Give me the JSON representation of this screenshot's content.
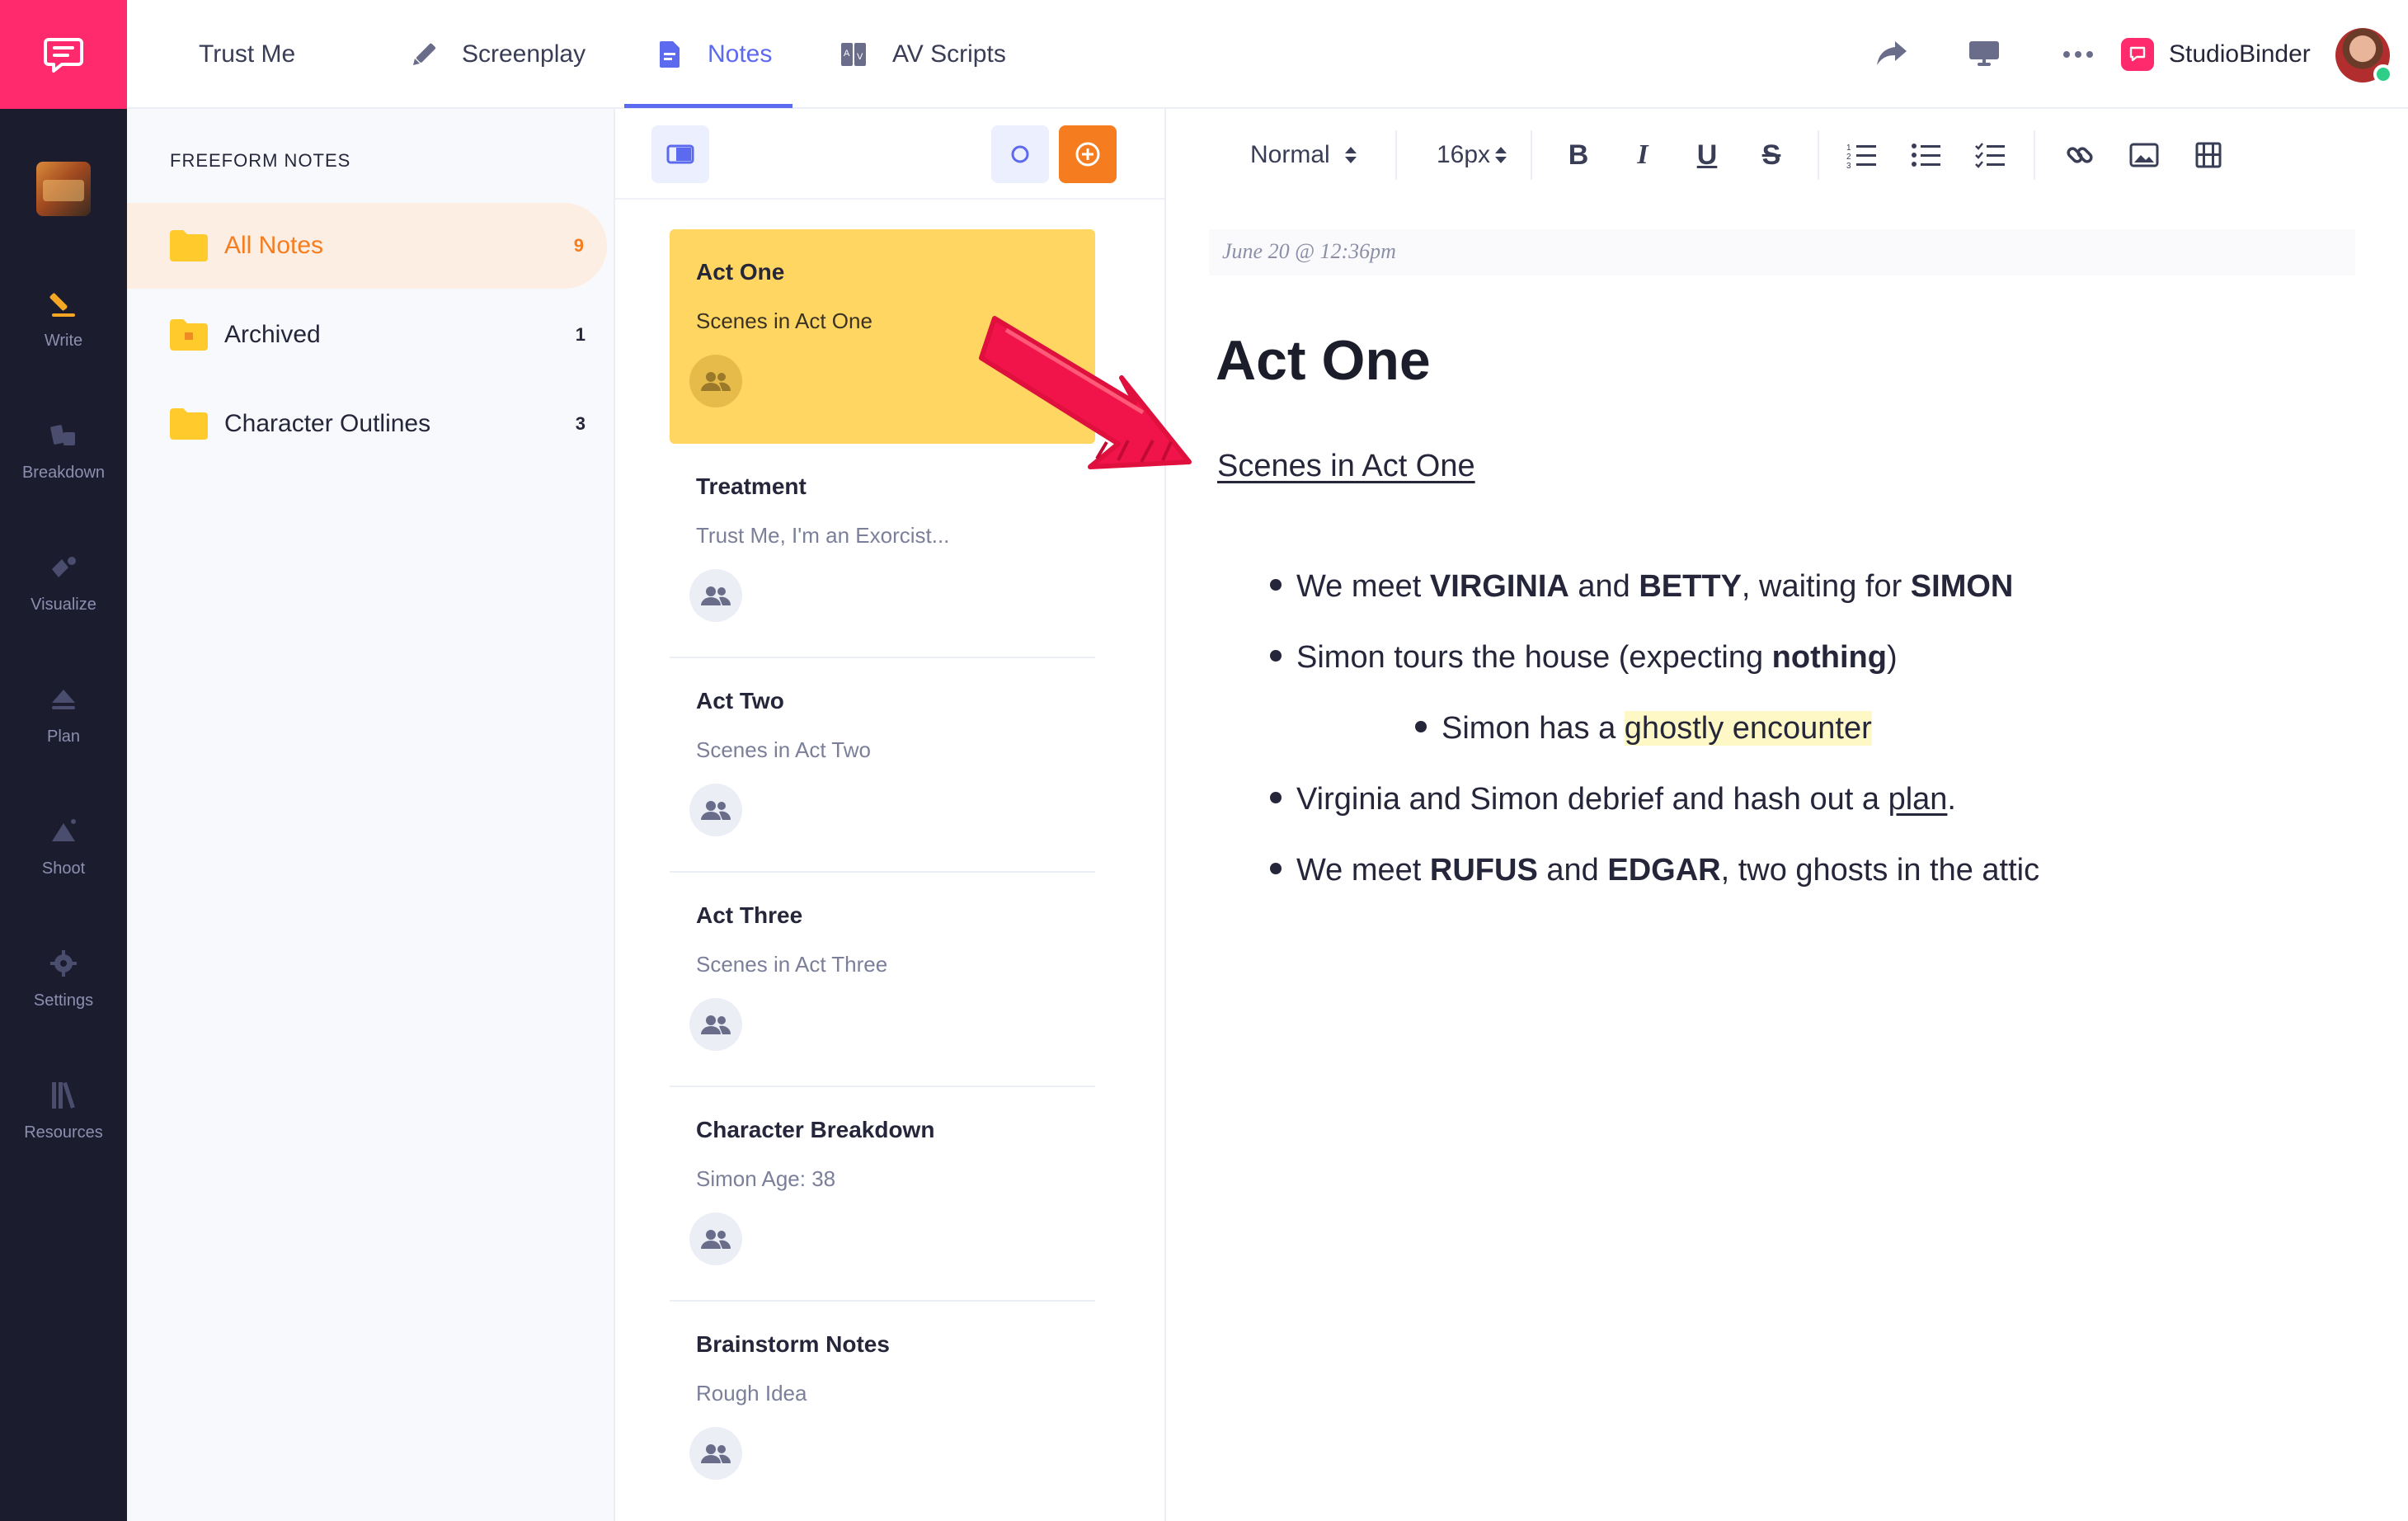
{
  "app": {
    "brand_color": "#ff2a6d",
    "accent_color": "#5c6af0",
    "orange_color": "#f57c1f"
  },
  "rail": {
    "items": [
      {
        "label": "Write",
        "icon": "pencil-icon"
      },
      {
        "label": "Breakdown",
        "icon": "breakdown-icon"
      },
      {
        "label": "Visualize",
        "icon": "visualize-icon"
      },
      {
        "label": "Plan",
        "icon": "plan-icon"
      },
      {
        "label": "Shoot",
        "icon": "shoot-icon"
      },
      {
        "label": "Settings",
        "icon": "gear-icon"
      },
      {
        "label": "Resources",
        "icon": "books-icon"
      }
    ]
  },
  "topbar": {
    "project": "Trust Me",
    "tabs": [
      {
        "label": "Screenplay",
        "icon": "pencil-icon"
      },
      {
        "label": "Notes",
        "icon": "document-icon",
        "active": true
      },
      {
        "label": "AV Scripts",
        "icon": "av-script-icon"
      }
    ],
    "account": "StudioBinder"
  },
  "folders": {
    "heading": "FREEFORM NOTES",
    "items": [
      {
        "name": "All Notes",
        "count": "9",
        "active": true
      },
      {
        "name": "Archived",
        "count": "1"
      },
      {
        "name": "Character Outlines",
        "count": "3"
      }
    ]
  },
  "notes": {
    "items": [
      {
        "title": "Act One",
        "subtitle": "Scenes in Act One",
        "selected": true
      },
      {
        "title": "Treatment",
        "subtitle": "Trust Me, I'm an Exorcist..."
      },
      {
        "title": "Act Two",
        "subtitle": "Scenes in Act Two"
      },
      {
        "title": "Act Three",
        "subtitle": "Scenes in Act Three"
      },
      {
        "title": "Character Breakdown",
        "subtitle": "Simon Age: 38"
      },
      {
        "title": "Brainstorm Notes",
        "subtitle": "Rough Idea"
      }
    ]
  },
  "editor": {
    "format": {
      "paragraph_style": "Normal",
      "font_size": "16px",
      "bold": "B",
      "italic": "I",
      "underline": "U",
      "strike": "S"
    },
    "timestamp": "June 20 @ 12:36pm",
    "title": "Act One",
    "subtitle": "Scenes in Act One",
    "bullets": [
      {
        "parts": [
          "We meet ",
          "VIRGINIA",
          " and ",
          "BETTY",
          ", waiting for ",
          "SIMON"
        ]
      },
      {
        "parts": [
          "Simon tours the house (expecting ",
          "nothing",
          ")"
        ]
      },
      {
        "parts": [
          "Simon has a ",
          "ghostly encounter"
        ]
      },
      {
        "parts": [
          "Virginia and Simon debrief and hash out a ",
          "plan",
          "."
        ]
      },
      {
        "parts": [
          "We meet ",
          "RUFUS",
          " and ",
          "EDGAR",
          ", two ghosts in the attic"
        ]
      }
    ]
  }
}
